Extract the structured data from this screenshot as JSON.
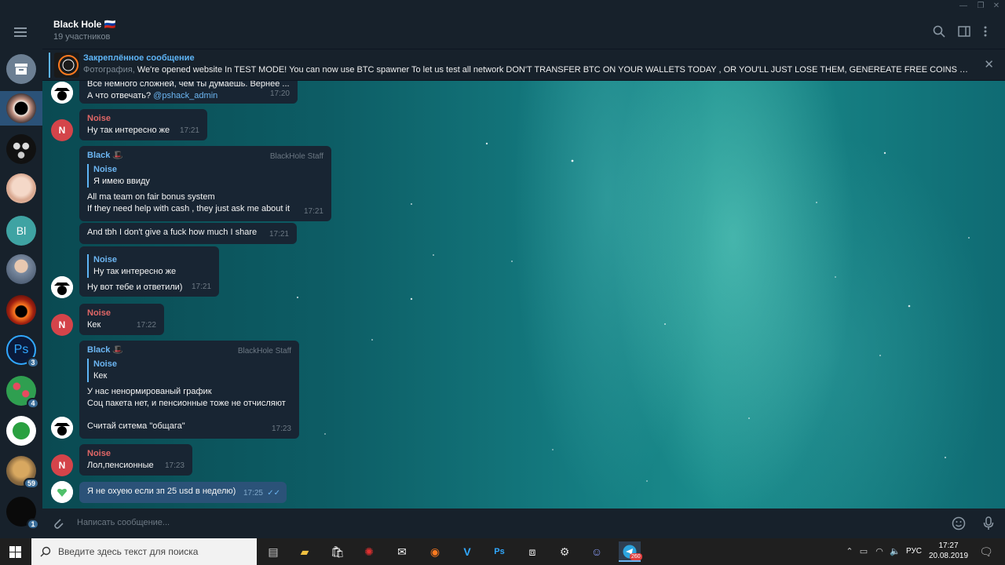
{
  "window": {
    "min": "—",
    "max": "❐",
    "close": "✕"
  },
  "header": {
    "title": "Black Hole 🇷🇺",
    "subtitle": "19 участников"
  },
  "pinned": {
    "title": "Закреплённое сообщение",
    "prefix": "Фотография, ",
    "text": "We're opened website In TEST MODE! You can now use BTC spawner To let us test all network  DON'T TRANSFER BTC ON YOUR WALLETS TODAY , OR YOU'LL JUST LOSE THEM, GENEREATE FREE COINS WITH YELL..."
  },
  "sidebar": {
    "items": [
      {
        "name": "archive",
        "badge": ""
      },
      {
        "name": "blackhole",
        "badge": ""
      },
      {
        "name": "group-faces",
        "badge": ""
      },
      {
        "name": "doll",
        "badge": ""
      },
      {
        "name": "bl",
        "initials": "Bl",
        "badge": ""
      },
      {
        "name": "man",
        "badge": ""
      },
      {
        "name": "eclipse",
        "badge": ""
      },
      {
        "name": "ps",
        "initials": "Ps",
        "badge": "3"
      },
      {
        "name": "flowers",
        "badge": "4"
      },
      {
        "name": "clover",
        "badge": ""
      },
      {
        "name": "cat",
        "badge": "59"
      },
      {
        "name": "dark",
        "badge": "1"
      }
    ]
  },
  "messages": {
    "m1": {
      "line1": "Все немного сложней, чем ты думаешь. Вернее ...",
      "line2": "А что отвечать? ",
      "mention": "@pshack_admin",
      "time": "17:20"
    },
    "m2": {
      "sender": "Noise",
      "text": "Ну так интересно же",
      "time": "17:21"
    },
    "m3": {
      "sender": "Black",
      "role": "BlackHole Staff",
      "quote_name": "Noise",
      "quote_text": "Я имею ввиду",
      "line1": "All ma team on fair bonus system",
      "line2": "If they need help with cash , they just ask me about it",
      "time": "17:21"
    },
    "m4": {
      "text": "And tbh I don't give a fuck how much I share",
      "time": "17:21"
    },
    "m5": {
      "quote_name": "Noise",
      "quote_text": "Ну так интересно же",
      "text": "Ну вот тебе и ответили)",
      "time": "17:21"
    },
    "m6": {
      "sender": "Noise",
      "text": "Кек",
      "time": "17:22"
    },
    "m7": {
      "sender": "Black",
      "role": "BlackHole Staff",
      "quote_name": "Noise",
      "quote_text": "Кек",
      "line1": "У нас ненормированый график",
      "line2": "Соц пакета нет, и пенсионные тоже не отчисляют",
      "line3": "Считай ситема \"общага\"",
      "time": "17:23"
    },
    "m8": {
      "sender": "Noise",
      "text": "Лол,пенсионные",
      "time": "17:23"
    },
    "m9": {
      "text": "Я не охуею если зп 25 usd в неделю)",
      "time": "17:25",
      "status": "✓✓"
    }
  },
  "avatars": {
    "noise_initial": "N"
  },
  "input": {
    "placeholder": "Написать сообщение..."
  },
  "taskbar": {
    "search_placeholder": "Введите здесь текст для поиска",
    "lang": "РУС",
    "time": "17:27",
    "date": "20.08.2019",
    "telegram_badge": "260"
  }
}
